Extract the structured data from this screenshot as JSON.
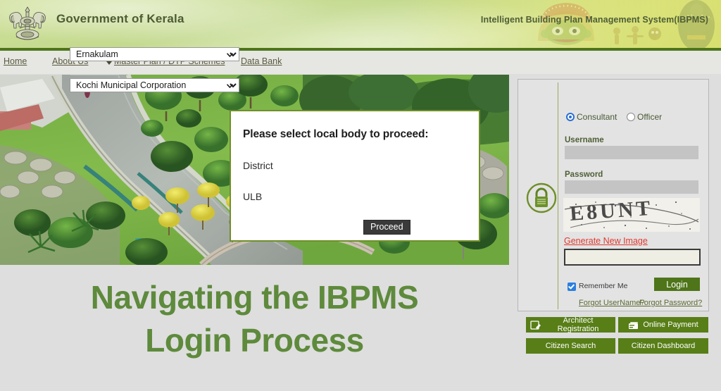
{
  "header": {
    "emblem_alt": "kerala-state-emblem",
    "title": "Government of Kerala",
    "subtitle": "Intelligent Building Plan Management System(IBPMS)"
  },
  "nav": {
    "items": [
      {
        "label": "Home",
        "name": "nav-home"
      },
      {
        "label": "About Us",
        "name": "nav-about"
      },
      {
        "label": "Master Plan / DTP Schemes",
        "name": "nav-master-plan"
      },
      {
        "label": "Data Bank",
        "name": "nav-data-bank"
      }
    ]
  },
  "modal": {
    "heading": "Please select local body to proceed:",
    "district_label": "District",
    "district_value": "Ernakulam",
    "ulb_label": "ULB",
    "ulb_value": "Kochi Municipal Corporation",
    "proceed_label": "Proceed"
  },
  "caption": {
    "line1": "Navigating the IBPMS",
    "line2": "Login Process"
  },
  "login": {
    "role_consultant": "Consultant",
    "role_officer": "Officer",
    "selected_role": "Consultant",
    "username_label": "Username",
    "username_value": "",
    "username_placeholder": "",
    "password_label": "Password",
    "password_value": "",
    "password_placeholder": "",
    "captcha_text": "E8UNT",
    "generate_new_image": "Generate New Image",
    "captcha_input_value": "",
    "captcha_input_placeholder": "",
    "remember_me": "Remember Me",
    "remember_checked": true,
    "login_label": "Login",
    "forgot_username": "Forgot UserName?",
    "forgot_password": "Forgot Password?"
  },
  "actions": [
    {
      "label": "Architect Registration",
      "icon": "document-edit-icon"
    },
    {
      "label": "Online Payment",
      "icon": "payment-card-icon"
    },
    {
      "label": "Citizen Search",
      "icon": ""
    },
    {
      "label": "Citizen Dashboard",
      "icon": ""
    }
  ],
  "colors": {
    "brand_green": "#4e7519",
    "header_green": "#c3d98d",
    "accent_olive": "#587e17",
    "caption_green": "#5e8a3c",
    "captcha_link_red": "#e03a2f",
    "page_bg": "#dedede"
  }
}
